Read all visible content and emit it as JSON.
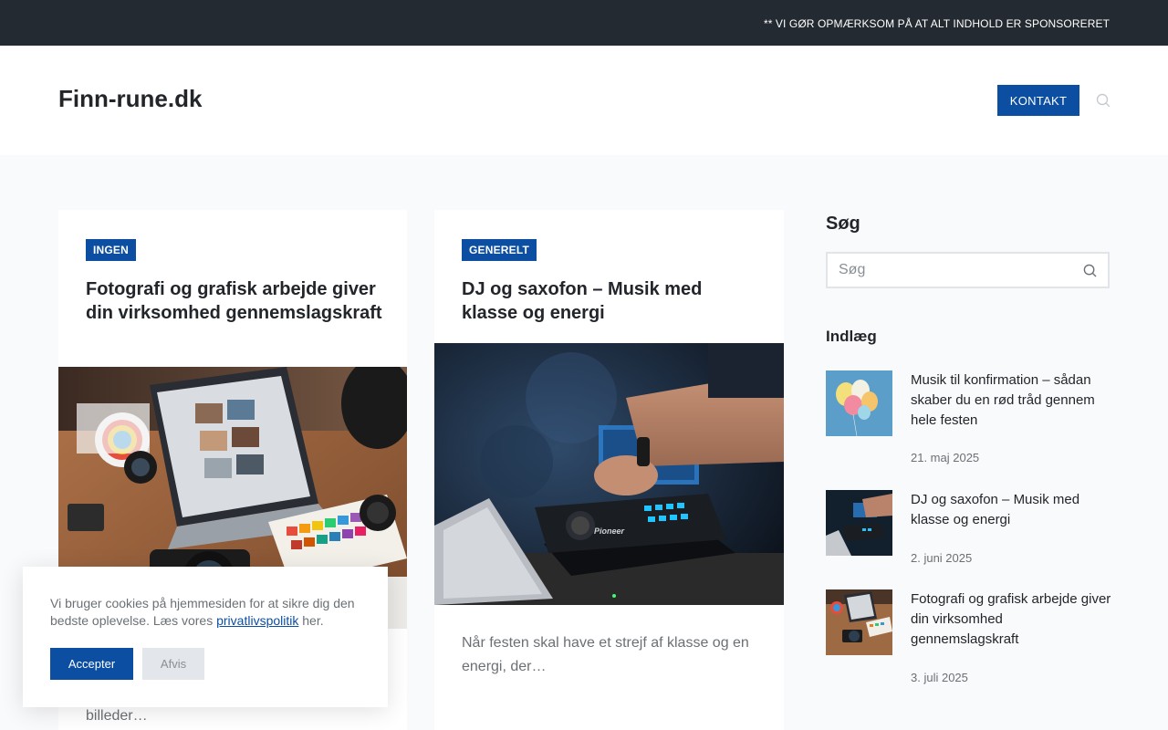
{
  "topbar": {
    "notice": "** VI GØR OPMÆRKSOM PÅ AT ALT INDHOLD ER SPONSORERET"
  },
  "header": {
    "site_title": "Finn-rune.dk",
    "contact_label": "KONTAKT",
    "search_icon": "search-icon"
  },
  "posts": [
    {
      "category": "INGEN",
      "title": "Fotografi og grafisk arbejde giver din virksomhed gennemslagskraft",
      "excerpt": "billeder…",
      "image": "photography-desk-image"
    },
    {
      "category": "GENERELT",
      "title": "DJ og saxofon – Musik med klasse og energi",
      "excerpt": "Når festen skal have et strejf af klasse og en energi, der…",
      "image": "dj-controller-image"
    }
  ],
  "sidebar": {
    "search_heading": "Søg",
    "search_placeholder": "Søg",
    "posts_heading": "Indlæg",
    "recent_posts": [
      {
        "title": "Musik til konfirmation – sådan skaber du en rød tråd gennem hele festen",
        "date": "21. maj 2025",
        "thumb": "balloons-image"
      },
      {
        "title": "DJ og saxofon – Musik med klasse og energi",
        "date": "2. juni 2025",
        "thumb": "dj-controller-image"
      },
      {
        "title": "Fotografi og grafisk arbejde giver din virksomhed gennemslagskraft",
        "date": "3. juli 2025",
        "thumb": "photography-desk-image"
      }
    ]
  },
  "cookie_banner": {
    "text_before": "Vi bruger cookies på hjemmesiden for at sikre dig den bedste oplevelse. Læs vores ",
    "link_label": "privatlivspolitik",
    "text_after": " her.",
    "accept_label": "Accepter",
    "decline_label": "Afvis"
  },
  "colors": {
    "topbar_bg": "#232a31",
    "accent": "#0b4ea2",
    "page_bg": "#f9fafb"
  }
}
